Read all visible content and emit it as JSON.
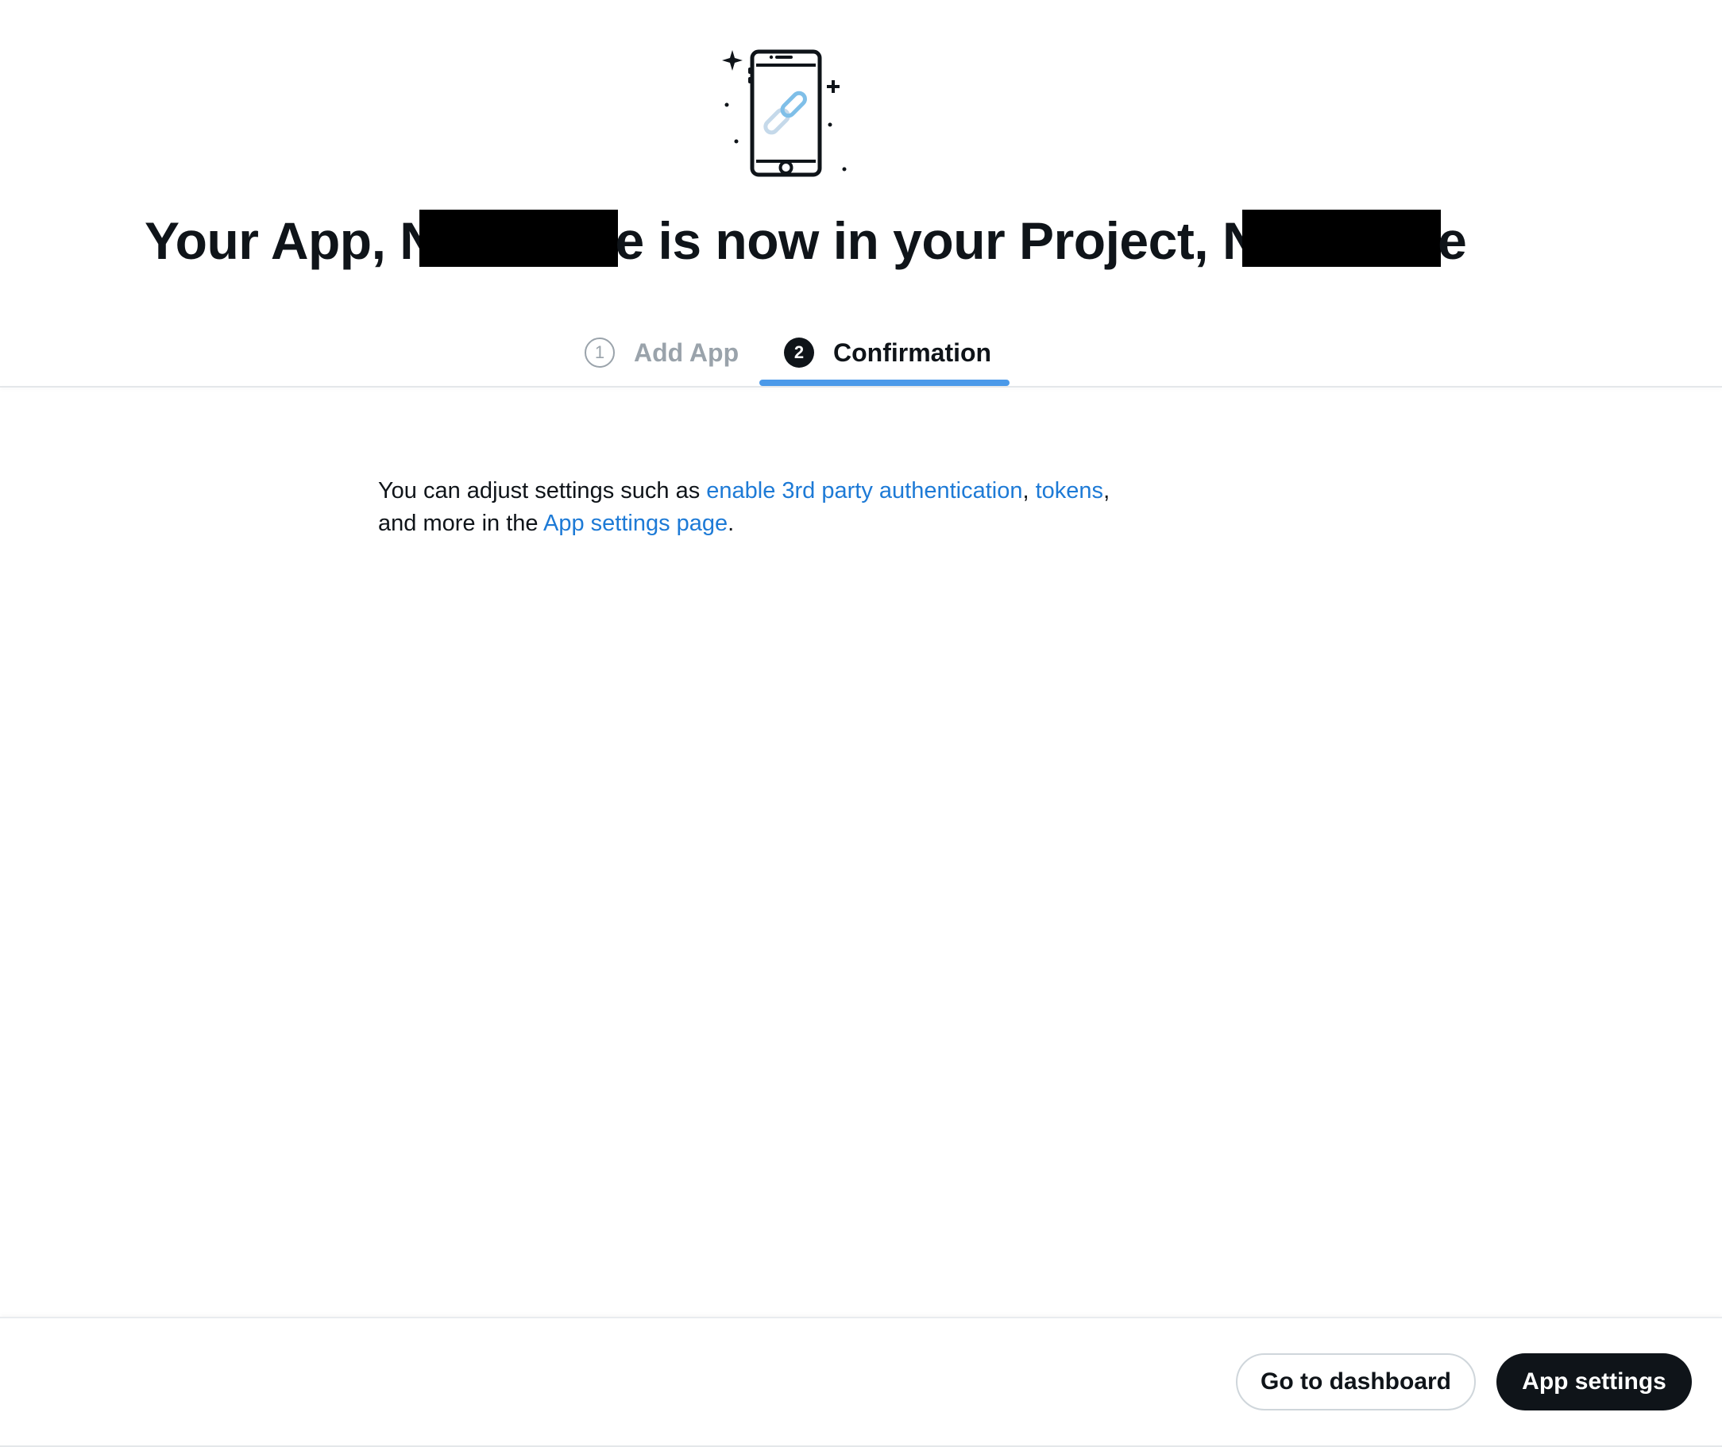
{
  "header": {
    "title_prefix": "Your App, N",
    "title_middle_suffix": "e is now in your Project, N",
    "title_end": "e"
  },
  "steps": [
    {
      "number": "1",
      "label": "Add App",
      "state": "complete"
    },
    {
      "number": "2",
      "label": "Confirmation",
      "state": "active"
    }
  ],
  "content": {
    "text_1": "You can adjust settings such as ",
    "link_auth": "enable 3rd party authentication",
    "text_2": ", ",
    "link_tokens": "tokens",
    "text_3": ",",
    "text_4": "and more in the ",
    "link_settings_page": "App settings page",
    "text_5": "."
  },
  "footer": {
    "dashboard_label": "Go to dashboard",
    "app_settings_label": "App settings"
  },
  "colors": {
    "link": "#1d7ad6",
    "tab_indicator": "#4a99e9",
    "primary_button": "#0f1419",
    "inactive_step": "#9aa3ab"
  },
  "icons": {
    "illustration": "phone-link-illustration"
  }
}
